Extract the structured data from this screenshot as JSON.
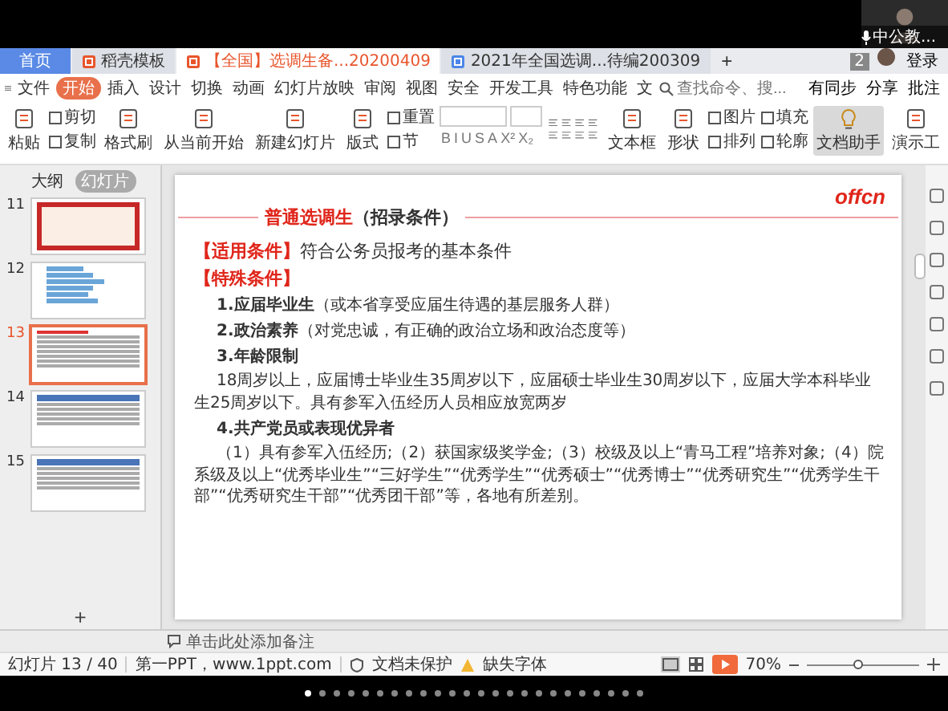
{
  "call": {
    "participant": "中公教..."
  },
  "tabs": [
    {
      "kind": "home",
      "label": "首页",
      "selected": false
    },
    {
      "kind": "template",
      "label": "稻壳模板",
      "selected": false
    },
    {
      "kind": "presentation",
      "label": "【全国】选调生备...20200409",
      "selected": true
    },
    {
      "kind": "document",
      "label": "2021年全国选调...待编200309",
      "selected": false
    }
  ],
  "tab_add": "+",
  "window_badge": "2",
  "login": "登录",
  "menu": [
    {
      "label": "文件",
      "selected": false
    },
    {
      "label": "开始",
      "selected": true
    },
    {
      "label": "插入",
      "selected": false
    },
    {
      "label": "设计",
      "selected": false
    },
    {
      "label": "切换",
      "selected": false
    },
    {
      "label": "动画",
      "selected": false
    },
    {
      "label": "幻灯片放映",
      "selected": false
    },
    {
      "label": "审阅",
      "selected": false
    },
    {
      "label": "视图",
      "selected": false
    },
    {
      "label": "安全",
      "selected": false
    },
    {
      "label": "开发工具",
      "selected": false
    },
    {
      "label": "特色功能",
      "selected": false
    },
    {
      "label": "文",
      "selected": false
    }
  ],
  "search": {
    "placeholder": "查找命令、搜..."
  },
  "menu_right": [
    "有同步",
    "分享",
    "批注"
  ],
  "ribbon": [
    {
      "kind": "large",
      "label": "粘贴"
    },
    {
      "kind": "pair",
      "items": [
        "剪切",
        "复制"
      ]
    },
    {
      "kind": "large",
      "label": "格式刷"
    },
    {
      "kind": "large",
      "label": "从当前开始"
    },
    {
      "kind": "large",
      "label": "新建幻灯片"
    },
    {
      "kind": "large",
      "label": "版式"
    },
    {
      "kind": "pair",
      "items": [
        "重置",
        "节"
      ]
    },
    {
      "kind": "font",
      "glyphs": [
        "B",
        "I",
        "U",
        "S",
        "A",
        "X²",
        "X₂"
      ]
    },
    {
      "kind": "paragraph"
    },
    {
      "kind": "large",
      "label": "文本框"
    },
    {
      "kind": "large",
      "label": "形状"
    },
    {
      "kind": "pair",
      "items": [
        "图片",
        "排列"
      ]
    },
    {
      "kind": "pair",
      "items": [
        "填充",
        "轮廓"
      ]
    },
    {
      "kind": "toggle",
      "label": "文档助手",
      "on": true
    },
    {
      "kind": "large",
      "label": "演示工"
    }
  ],
  "panel_tabs": [
    {
      "label": "大纲",
      "selected": false
    },
    {
      "label": "幻灯片",
      "selected": true
    }
  ],
  "thumbnails": [
    {
      "number": "11",
      "kind": "cover",
      "selected": false
    },
    {
      "number": "12",
      "kind": "chart",
      "selected": false
    },
    {
      "number": "13",
      "kind": "text",
      "selected": true
    },
    {
      "number": "14",
      "kind": "table",
      "selected": false
    },
    {
      "number": "15",
      "kind": "table",
      "selected": false
    }
  ],
  "add_slide": "+",
  "slide": {
    "logo": "offcn",
    "title": "普通选调生",
    "title_note": "（招录条件）",
    "items": [
      {
        "kind": "labeled",
        "label": "【适用条件】",
        "text": "符合公务员报考的基本条件"
      },
      {
        "kind": "label",
        "label": "【特殊条件】"
      },
      {
        "kind": "item",
        "text": "**1.应届毕业生**（或本省享受应届生待遇的基层服务人群）"
      },
      {
        "kind": "item",
        "text": "**2.政治素养**（对党忠诚，有正确的政治立场和政治态度等）"
      },
      {
        "kind": "item",
        "text": "**3.年龄限制**"
      },
      {
        "kind": "para",
        "text": "18周岁以上，应届博士毕业生35周岁以下，应届硕士毕业生30周岁以下，应届大学本科毕业生25周岁以下。具有参军入伍经历人员相应放宽两岁"
      },
      {
        "kind": "item",
        "text": "**4.共产党员或表现优异者**"
      },
      {
        "kind": "para",
        "text": "（1）具有参军入伍经历;（2）获国家级奖学金;（3）校级及以上“青马工程”培养对象;（4）院系级及以上“优秀毕业生”“三好学生”“优秀学生”“优秀硕士”“优秀博士”“优秀研究生”“优秀学生干部”“优秀研究生干部”“优秀团干部”等，各地有所差别。"
      }
    ]
  },
  "notes": {
    "placeholder": "单击此处添加备注"
  },
  "status_bar": {
    "slide_count": "幻灯片 13 / 40",
    "theme": "第一PPT，www.1ppt.com",
    "protection": "文档未保护",
    "fonts": "缺失字体",
    "zoom": "70%",
    "zoom_level": {
      "level": 0.45
    }
  },
  "pager": [
    {
      "selected": true
    },
    {
      "selected": false
    },
    {
      "selected": false
    },
    {
      "selected": false
    },
    {
      "selected": false
    },
    {
      "selected": false
    },
    {
      "selected": false
    },
    {
      "selected": false
    },
    {
      "selected": false
    },
    {
      "selected": false
    },
    {
      "selected": false
    },
    {
      "selected": false
    },
    {
      "selected": false
    },
    {
      "selected": false
    },
    {
      "selected": false
    },
    {
      "selected": false
    },
    {
      "selected": false
    },
    {
      "selected": false
    },
    {
      "selected": false
    },
    {
      "selected": false
    },
    {
      "selected": false
    },
    {
      "selected": false
    },
    {
      "selected": false
    },
    {
      "selected": false
    }
  ]
}
